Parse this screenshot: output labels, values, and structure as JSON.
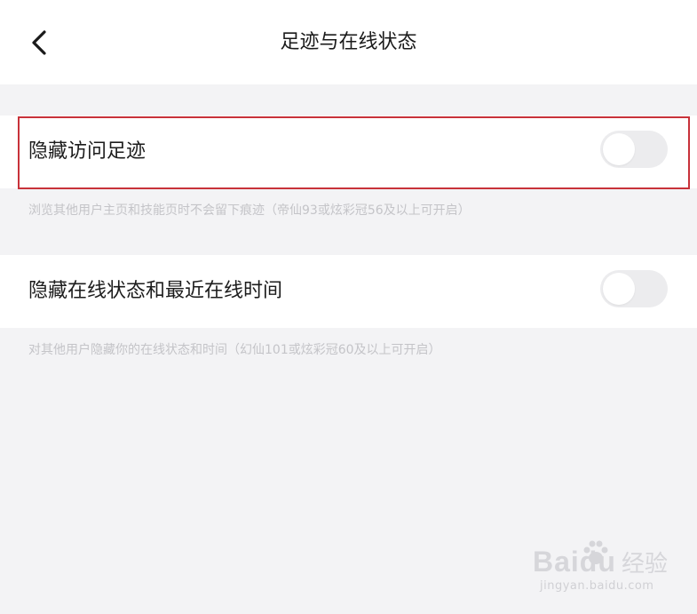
{
  "header": {
    "title": "足迹与在线状态",
    "back_icon": "chevron-left-icon"
  },
  "settings": [
    {
      "label": "隐藏访问足迹",
      "enabled": false,
      "hint": "浏览其他用户主页和技能页时不会留下痕迹（帝仙93或炫彩冠56及以上可开启）",
      "highlighted": true
    },
    {
      "label": "隐藏在线状态和最近在线时间",
      "enabled": false,
      "hint": "对其他用户隐藏你的在线状态和时间（幻仙101或炫彩冠60及以上可开启）",
      "highlighted": false
    }
  ],
  "colors": {
    "background": "#f3f3f5",
    "surface": "#ffffff",
    "highlight_border": "#c8323a",
    "toggle_off": "#ececee"
  },
  "watermark": {
    "brand": "Bai",
    "brand_suffix": "du",
    "product": "经验",
    "url": "jingyan.baidu.com"
  }
}
